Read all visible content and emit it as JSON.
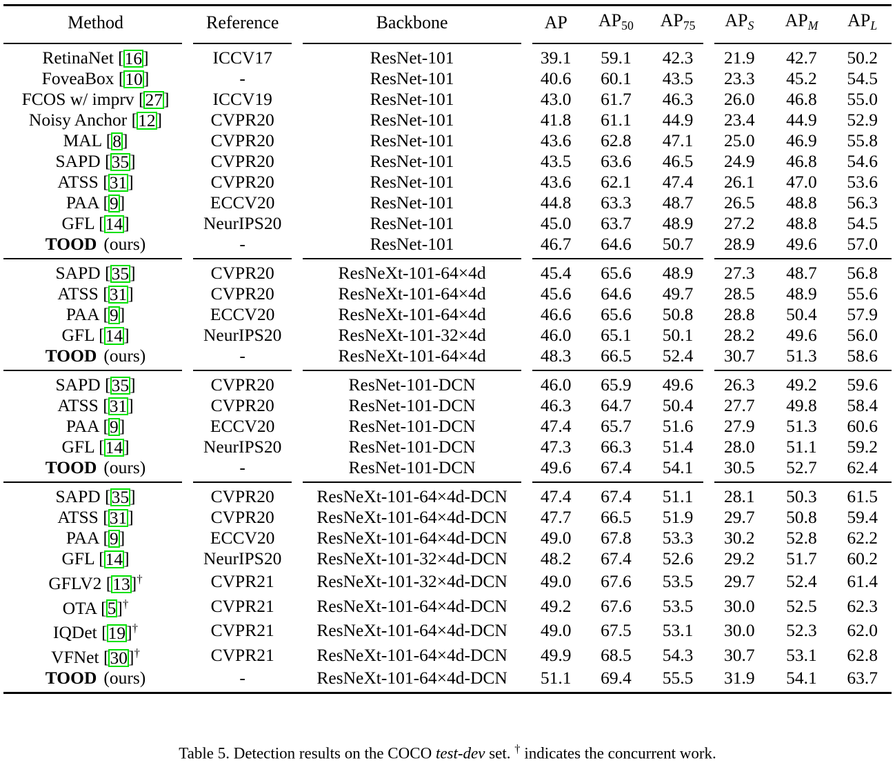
{
  "table": {
    "label": "Table 5",
    "columns": [
      {
        "key": "method",
        "label": "Method"
      },
      {
        "key": "reference",
        "label": "Reference"
      },
      {
        "key": "backbone",
        "label": "Backbone"
      },
      {
        "key": "ap",
        "label": "AP",
        "sub": "",
        "sub_style": ""
      },
      {
        "key": "ap50",
        "label": "AP",
        "sub": "50",
        "sub_style": "roman"
      },
      {
        "key": "ap75",
        "label": "AP",
        "sub": "75",
        "sub_style": "roman"
      },
      {
        "key": "aps",
        "label": "AP",
        "sub": "S",
        "sub_style": "italic"
      },
      {
        "key": "apm",
        "label": "AP",
        "sub": "M",
        "sub_style": "italic"
      },
      {
        "key": "apl",
        "label": "AP",
        "sub": "L",
        "sub_style": "italic"
      }
    ],
    "blocks": [
      {
        "rows": [
          {
            "name": "RetinaNet",
            "cite": "16",
            "dagger": false,
            "bold": false,
            "ours": false,
            "reference": "ICCV17",
            "backbone": "ResNet-101",
            "ap": "39.1",
            "ap50": "59.1",
            "ap75": "42.3",
            "aps": "21.9",
            "apm": "42.7",
            "apl": "50.2"
          },
          {
            "name": "FoveaBox",
            "cite": "10",
            "dagger": false,
            "bold": false,
            "ours": false,
            "reference": "-",
            "backbone": "ResNet-101",
            "ap": "40.6",
            "ap50": "60.1",
            "ap75": "43.5",
            "aps": "23.3",
            "apm": "45.2",
            "apl": "54.5"
          },
          {
            "name": "FCOS w/ imprv",
            "cite": "27",
            "dagger": false,
            "bold": false,
            "ours": false,
            "reference": "ICCV19",
            "backbone": "ResNet-101",
            "ap": "43.0",
            "ap50": "61.7",
            "ap75": "46.3",
            "aps": "26.0",
            "apm": "46.8",
            "apl": "55.0"
          },
          {
            "name": "Noisy Anchor",
            "cite": "12",
            "dagger": false,
            "bold": false,
            "ours": false,
            "reference": "CVPR20",
            "backbone": "ResNet-101",
            "ap": "41.8",
            "ap50": "61.1",
            "ap75": "44.9",
            "aps": "23.4",
            "apm": "44.9",
            "apl": "52.9"
          },
          {
            "name": "MAL",
            "cite": "8",
            "dagger": false,
            "bold": false,
            "ours": false,
            "reference": "CVPR20",
            "backbone": "ResNet-101",
            "ap": "43.6",
            "ap50": "62.8",
            "ap75": "47.1",
            "aps": "25.0",
            "apm": "46.9",
            "apl": "55.8"
          },
          {
            "name": "SAPD",
            "cite": "35",
            "dagger": false,
            "bold": false,
            "ours": false,
            "reference": "CVPR20",
            "backbone": "ResNet-101",
            "ap": "43.5",
            "ap50": "63.6",
            "ap75": "46.5",
            "aps": "24.9",
            "apm": "46.8",
            "apl": "54.6"
          },
          {
            "name": "ATSS",
            "cite": "31",
            "dagger": false,
            "bold": false,
            "ours": false,
            "reference": "CVPR20",
            "backbone": "ResNet-101",
            "ap": "43.6",
            "ap50": "62.1",
            "ap75": "47.4",
            "aps": "26.1",
            "apm": "47.0",
            "apl": "53.6"
          },
          {
            "name": "PAA",
            "cite": "9",
            "dagger": false,
            "bold": false,
            "ours": false,
            "reference": "ECCV20",
            "backbone": "ResNet-101",
            "ap": "44.8",
            "ap50": "63.3",
            "ap75": "48.7",
            "aps": "26.5",
            "apm": "48.8",
            "apl": "56.3"
          },
          {
            "name": "GFL",
            "cite": "14",
            "dagger": false,
            "bold": false,
            "ours": false,
            "reference": "NeurIPS20",
            "backbone": "ResNet-101",
            "ap": "45.0",
            "ap50": "63.7",
            "ap75": "48.9",
            "aps": "27.2",
            "apm": "48.8",
            "apl": "54.5"
          },
          {
            "name": "TOOD",
            "cite": "",
            "dagger": false,
            "bold": true,
            "ours": true,
            "ours_label": "(ours)",
            "reference": "-",
            "backbone": "ResNet-101",
            "ap": "46.7",
            "ap50": "64.6",
            "ap75": "50.7",
            "aps": "28.9",
            "apm": "49.6",
            "apl": "57.0"
          }
        ]
      },
      {
        "rows": [
          {
            "name": "SAPD",
            "cite": "35",
            "dagger": false,
            "bold": false,
            "ours": false,
            "reference": "CVPR20",
            "backbone": "ResNeXt-101-64×4d",
            "ap": "45.4",
            "ap50": "65.6",
            "ap75": "48.9",
            "aps": "27.3",
            "apm": "48.7",
            "apl": "56.8"
          },
          {
            "name": "ATSS",
            "cite": "31",
            "dagger": false,
            "bold": false,
            "ours": false,
            "reference": "CVPR20",
            "backbone": "ResNeXt-101-64×4d",
            "ap": "45.6",
            "ap50": "64.6",
            "ap75": "49.7",
            "aps": "28.5",
            "apm": "48.9",
            "apl": "55.6"
          },
          {
            "name": "PAA",
            "cite": "9",
            "dagger": false,
            "bold": false,
            "ours": false,
            "reference": "ECCV20",
            "backbone": "ResNeXt-101-64×4d",
            "ap": "46.6",
            "ap50": "65.6",
            "ap75": "50.8",
            "aps": "28.8",
            "apm": "50.4",
            "apl": "57.9"
          },
          {
            "name": "GFL",
            "cite": "14",
            "dagger": false,
            "bold": false,
            "ours": false,
            "reference": "NeurIPS20",
            "backbone": "ResNeXt-101-32×4d",
            "ap": "46.0",
            "ap50": "65.1",
            "ap75": "50.1",
            "aps": "28.2",
            "apm": "49.6",
            "apl": "56.0"
          },
          {
            "name": "TOOD",
            "cite": "",
            "dagger": false,
            "bold": true,
            "ours": true,
            "ours_label": "(ours)",
            "reference": "-",
            "backbone": "ResNeXt-101-64×4d",
            "ap": "48.3",
            "ap50": "66.5",
            "ap75": "52.4",
            "aps": "30.7",
            "apm": "51.3",
            "apl": "58.6"
          }
        ]
      },
      {
        "rows": [
          {
            "name": "SAPD",
            "cite": "35",
            "dagger": false,
            "bold": false,
            "ours": false,
            "reference": "CVPR20",
            "backbone": "ResNet-101-DCN",
            "ap": "46.0",
            "ap50": "65.9",
            "ap75": "49.6",
            "aps": "26.3",
            "apm": "49.2",
            "apl": "59.6"
          },
          {
            "name": "ATSS",
            "cite": "31",
            "dagger": false,
            "bold": false,
            "ours": false,
            "reference": "CVPR20",
            "backbone": "ResNet-101-DCN",
            "ap": "46.3",
            "ap50": "64.7",
            "ap75": "50.4",
            "aps": "27.7",
            "apm": "49.8",
            "apl": "58.4"
          },
          {
            "name": "PAA",
            "cite": "9",
            "dagger": false,
            "bold": false,
            "ours": false,
            "reference": "ECCV20",
            "backbone": "ResNet-101-DCN",
            "ap": "47.4",
            "ap50": "65.7",
            "ap75": "51.6",
            "aps": "27.9",
            "apm": "51.3",
            "apl": "60.6"
          },
          {
            "name": "GFL",
            "cite": "14",
            "dagger": false,
            "bold": false,
            "ours": false,
            "reference": "NeurIPS20",
            "backbone": "ResNet-101-DCN",
            "ap": "47.3",
            "ap50": "66.3",
            "ap75": "51.4",
            "aps": "28.0",
            "apm": "51.1",
            "apl": "59.2"
          },
          {
            "name": "TOOD",
            "cite": "",
            "dagger": false,
            "bold": true,
            "ours": true,
            "ours_label": "(ours)",
            "reference": "-",
            "backbone": "ResNet-101-DCN",
            "ap": "49.6",
            "ap50": "67.4",
            "ap75": "54.1",
            "aps": "30.5",
            "apm": "52.7",
            "apl": "62.4"
          }
        ]
      },
      {
        "rows": [
          {
            "name": "SAPD",
            "cite": "35",
            "dagger": false,
            "bold": false,
            "ours": false,
            "reference": "CVPR20",
            "backbone": "ResNeXt-101-64×4d-DCN",
            "ap": "47.4",
            "ap50": "67.4",
            "ap75": "51.1",
            "aps": "28.1",
            "apm": "50.3",
            "apl": "61.5"
          },
          {
            "name": "ATSS",
            "cite": "31",
            "dagger": false,
            "bold": false,
            "ours": false,
            "reference": "CVPR20",
            "backbone": "ResNeXt-101-64×4d-DCN",
            "ap": "47.7",
            "ap50": "66.5",
            "ap75": "51.9",
            "aps": "29.7",
            "apm": "50.8",
            "apl": "59.4"
          },
          {
            "name": "PAA",
            "cite": "9",
            "dagger": false,
            "bold": false,
            "ours": false,
            "reference": "ECCV20",
            "backbone": "ResNeXt-101-64×4d-DCN",
            "ap": "49.0",
            "ap50": "67.8",
            "ap75": "53.3",
            "aps": "30.2",
            "apm": "52.8",
            "apl": "62.2"
          },
          {
            "name": "GFL",
            "cite": "14",
            "dagger": false,
            "bold": false,
            "ours": false,
            "reference": "NeurIPS20",
            "backbone": "ResNeXt-101-32×4d-DCN",
            "ap": "48.2",
            "ap50": "67.4",
            "ap75": "52.6",
            "aps": "29.2",
            "apm": "51.7",
            "apl": "60.2"
          },
          {
            "name": "GFLV2",
            "cite": "13",
            "dagger": true,
            "bold": false,
            "ours": false,
            "reference": "CVPR21",
            "backbone": "ResNeXt-101-32×4d-DCN",
            "ap": "49.0",
            "ap50": "67.6",
            "ap75": "53.5",
            "aps": "29.7",
            "apm": "52.4",
            "apl": "61.4"
          },
          {
            "name": "OTA",
            "cite": "5",
            "dagger": true,
            "bold": false,
            "ours": false,
            "reference": "CVPR21",
            "backbone": "ResNeXt-101-64×4d-DCN",
            "ap": "49.2",
            "ap50": "67.6",
            "ap75": "53.5",
            "aps": "30.0",
            "apm": "52.5",
            "apl": "62.3"
          },
          {
            "name": "IQDet",
            "cite": "19",
            "dagger": true,
            "bold": false,
            "ours": false,
            "reference": "CVPR21",
            "backbone": "ResNeXt-101-64×4d-DCN",
            "ap": "49.0",
            "ap50": "67.5",
            "ap75": "53.1",
            "aps": "30.0",
            "apm": "52.3",
            "apl": "62.0"
          },
          {
            "name": "VFNet",
            "cite": "30",
            "dagger": true,
            "bold": false,
            "ours": false,
            "reference": "CVPR21",
            "backbone": "ResNeXt-101-64×4d-DCN",
            "ap": "49.9",
            "ap50": "68.5",
            "ap75": "54.3",
            "aps": "30.7",
            "apm": "53.1",
            "apl": "62.8"
          },
          {
            "name": "TOOD",
            "cite": "",
            "dagger": false,
            "bold": true,
            "ours": true,
            "ours_label": "(ours)",
            "reference": "-",
            "backbone": "ResNeXt-101-64×4d-DCN",
            "ap": "51.1",
            "ap50": "69.4",
            "ap75": "55.5",
            "aps": "31.9",
            "apm": "54.1",
            "apl": "63.7"
          }
        ]
      }
    ]
  },
  "caption": {
    "prefix": "Table 5. Detection results on the COCO ",
    "italic": "test-dev",
    "middle": " set. ",
    "dagger": "†",
    "suffix": " indicates the concurrent work."
  },
  "colors": {
    "citation_box": "#00e000",
    "rule": "#000000",
    "text": "#000000",
    "background": "#ffffff"
  }
}
